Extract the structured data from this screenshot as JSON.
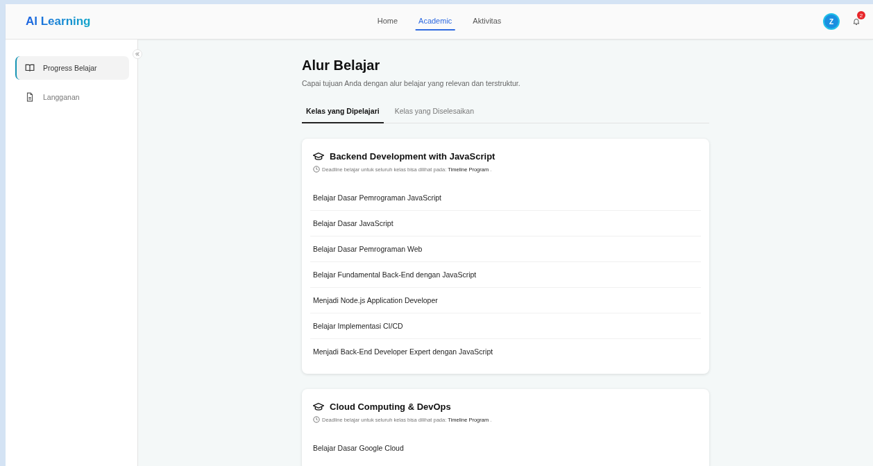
{
  "header": {
    "logo": "AI Learning",
    "nav": [
      {
        "label": "Home",
        "selected": false
      },
      {
        "label": "Academic",
        "selected": true
      },
      {
        "label": "Aktivitas",
        "selected": false
      }
    ],
    "avatar": "Z",
    "notification_count": "2"
  },
  "sidebar": {
    "items": [
      {
        "label": "Progress Belajar",
        "kind": "book",
        "selected": true
      },
      {
        "label": "Langganan",
        "kind": "document",
        "selected": false
      }
    ]
  },
  "page": {
    "title": "Alur Belajar",
    "subtitle": "Capai tujuan Anda dengan alur belajar yang relevan dan terstruktur."
  },
  "tabs": [
    {
      "label": "Kelas yang Dipelajari",
      "selected": true
    },
    {
      "label": "Kelas yang Diselesaikan",
      "selected": false
    }
  ],
  "paths": [
    {
      "title": "Backend Development with JavaScript",
      "deadline_text": "Deadline belajar untuk seluruh kelas bisa dilihat pada:",
      "deadline_link": "Timeline Program",
      "deadline_end": ".",
      "classes": [
        "Belajar Dasar Pemrograman JavaScript",
        "Belajar Dasar JavaScript",
        "Belajar Dasar Pemrograman Web",
        "Belajar Fundamental Back-End dengan JavaScript",
        "Menjadi Node.js Application Developer",
        "Belajar Implementasi CI/CD",
        "Menjadi Back-End Developer Expert dengan JavaScript"
      ]
    },
    {
      "title": "Cloud Computing & DevOps",
      "deadline_text": "Deadline belajar untuk seluruh kelas bisa dilihat pada:",
      "deadline_link": "Timeline Program",
      "deadline_end": ".",
      "classes": [
        "Belajar Dasar Google Cloud"
      ]
    }
  ]
}
